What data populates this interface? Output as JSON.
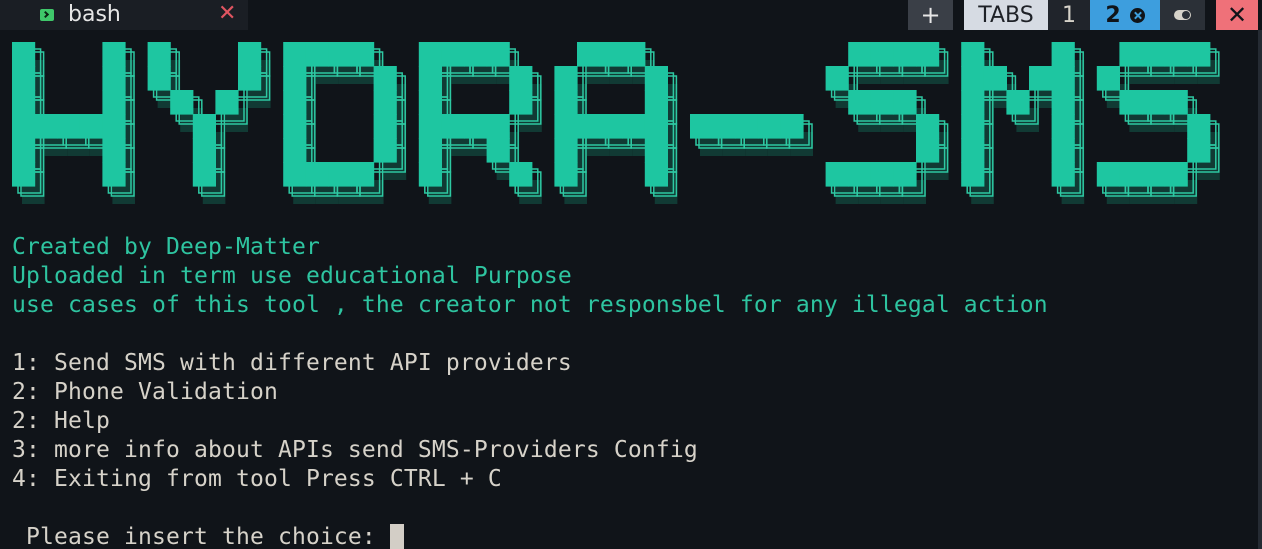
{
  "tab": {
    "title": "bash",
    "close": "✕",
    "icon": "terminal-icon"
  },
  "toolbar": {
    "new_tab": "+",
    "tabs_label": "TABS",
    "tab_one": "1",
    "tab_two": "2",
    "close_window": "✕"
  },
  "banner": {
    "text": "HYDRA-SMS",
    "color": "#1ec6a1"
  },
  "intro": [
    "Created by Deep-Matter",
    "Uploaded in term use educational Purpose",
    "use cases of this tool , the creator not responsbel for any illegal action"
  ],
  "menu": [
    "1: Send SMS with different API providers",
    "2: Phone Validation",
    "2: Help",
    "3: more info about APIs send SMS-Providers Config",
    "4: Exiting from tool Press CTRL + C"
  ],
  "prompt": " Please insert the choice: "
}
